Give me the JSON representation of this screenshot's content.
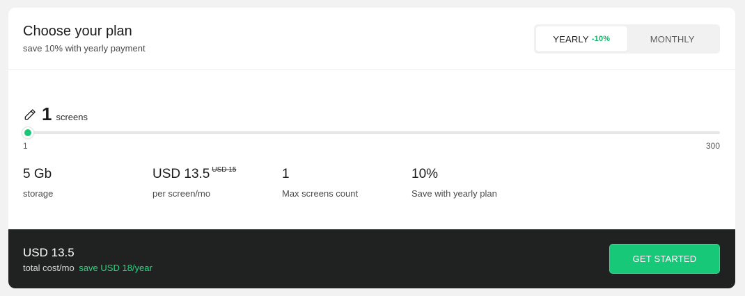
{
  "header": {
    "title": "Choose your plan",
    "subtitle": "save 10% with yearly payment"
  },
  "billing_toggle": {
    "options": [
      {
        "label": "YEARLY",
        "badge": "-10%",
        "selected": true
      },
      {
        "label": "MONTHLY",
        "selected": false
      }
    ]
  },
  "screens": {
    "count": "1",
    "unit": "screens",
    "icon": "pencil-icon"
  },
  "slider": {
    "min_label": "1",
    "max_label": "300",
    "min": 1,
    "max": 300,
    "value": 1
  },
  "stats": [
    {
      "value": "5 Gb",
      "label": "storage"
    },
    {
      "value": "USD 13.5",
      "old_value": "USD 15",
      "label": "per screen/mo"
    },
    {
      "value": "1",
      "label": "Max screens count"
    },
    {
      "value": "10%",
      "label": "Save with yearly plan"
    }
  ],
  "footer": {
    "total_price": "USD 13.5",
    "total_note": "total cost/mo",
    "savings": "save USD 18/year",
    "cta_label": "GET STARTED"
  },
  "colors": {
    "accent": "#17c878",
    "discount": "#12b76a",
    "footer_bg": "#202221"
  }
}
